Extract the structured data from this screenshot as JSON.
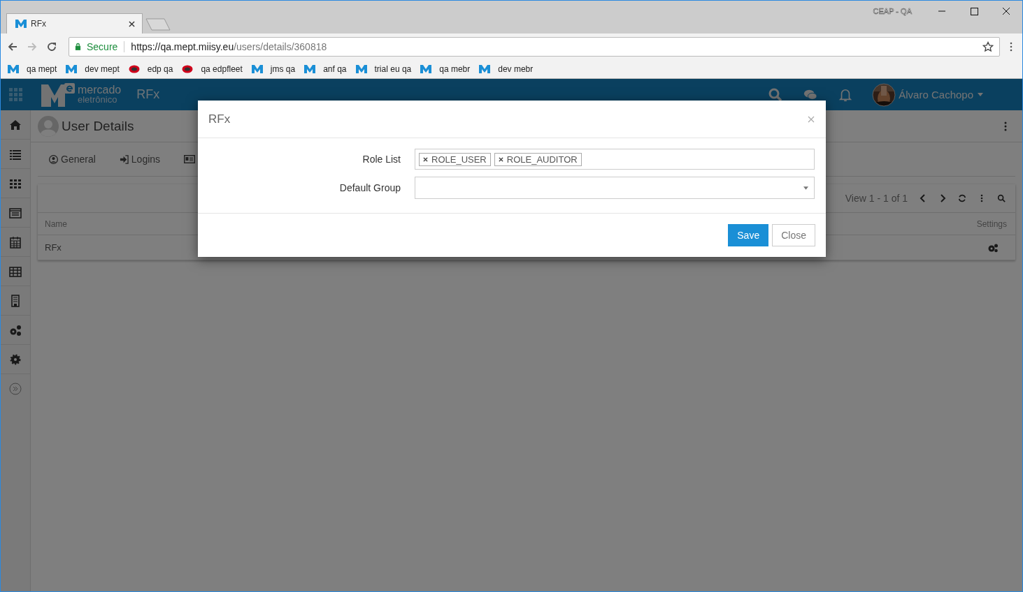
{
  "browser": {
    "window_label": "CEAP - QA",
    "tabs": [
      {
        "title": "RFx",
        "selected": true
      }
    ],
    "address": {
      "secure_label": "Secure",
      "url_host": "https://qa.mept.miisy.eu",
      "url_path": "/users/details/360818"
    },
    "bookmarks": [
      {
        "label": "qa mept",
        "kind": "m"
      },
      {
        "label": "dev mept",
        "kind": "m"
      },
      {
        "label": "edp qa",
        "kind": "edp"
      },
      {
        "label": "qa edpfleet",
        "kind": "edp"
      },
      {
        "label": "jms qa",
        "kind": "m"
      },
      {
        "label": "anf qa",
        "kind": "m"
      },
      {
        "label": "trial eu qa",
        "kind": "m"
      },
      {
        "label": "qa mebr",
        "kind": "m"
      },
      {
        "label": "dev mebr",
        "kind": "m"
      }
    ]
  },
  "app": {
    "brand": {
      "name": "mercado",
      "subtitle": "eletrônico"
    },
    "module": "RFx",
    "user": "Álvaro Cachopo"
  },
  "page": {
    "title": "User Details",
    "tabs": [
      {
        "label": "General",
        "kind": "user"
      },
      {
        "label": "Logins",
        "kind": "login"
      },
      {
        "kind": "card"
      }
    ],
    "grid": {
      "pager": "View 1 - 1 of 1",
      "columns": [
        "Name",
        "Settings"
      ],
      "rows": [
        {
          "name": "RFx"
        }
      ]
    }
  },
  "modal": {
    "title": "RFx",
    "role_list": {
      "label": "Role List",
      "tags": [
        "ROLE_USER",
        "ROLE_AUDITOR"
      ]
    },
    "default_group": {
      "label": "Default Group"
    },
    "buttons": [
      {
        "label": "Save",
        "kind": "primary"
      },
      {
        "label": "Close",
        "kind": "default"
      }
    ]
  }
}
